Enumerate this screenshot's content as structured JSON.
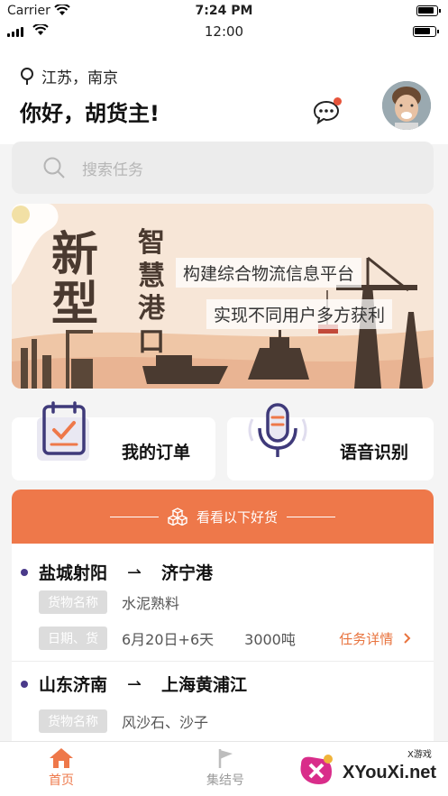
{
  "status_bar": {
    "carrier": "Carrier",
    "time_top": "7:24 PM",
    "time_bottom": "12:00"
  },
  "header": {
    "location": "江苏，南京",
    "greeting": "你好，胡货主!",
    "message_icon": "chat-bubble-icon",
    "avatar_icon": "avatar"
  },
  "search": {
    "placeholder": "搜索任务"
  },
  "banner": {
    "big_char_1": "新",
    "big_char_2": "型",
    "vertical_text": "智慧港口",
    "line_1": "构建综合物流信息平台",
    "line_2": "实现不同用户多方获利"
  },
  "cards": {
    "orders_label": "我的订单",
    "voice_label": "语音识别"
  },
  "list": {
    "header": "看看以下好货",
    "items": [
      {
        "from": "盐城射阳",
        "arrow": "⇀",
        "to": "济宁港",
        "goods_tag": "货物名称",
        "goods": "水泥熟料",
        "date_tag": "日期、货",
        "date": "6月20日+6天",
        "weight": "3000吨",
        "detail": "任务详情"
      },
      {
        "from": "山东济南",
        "arrow": "⇀",
        "to": "上海黄浦江",
        "goods_tag": "货物名称",
        "goods": "风沙石、沙子"
      }
    ]
  },
  "tabbar": {
    "home": "首页",
    "assembly": "集结号"
  },
  "watermark": {
    "brand": "XYouXi.net",
    "small": "X游戏"
  },
  "colors": {
    "accent": "#ee784a",
    "detail": "#e8743f",
    "route_dot": "#4a3a8a"
  }
}
